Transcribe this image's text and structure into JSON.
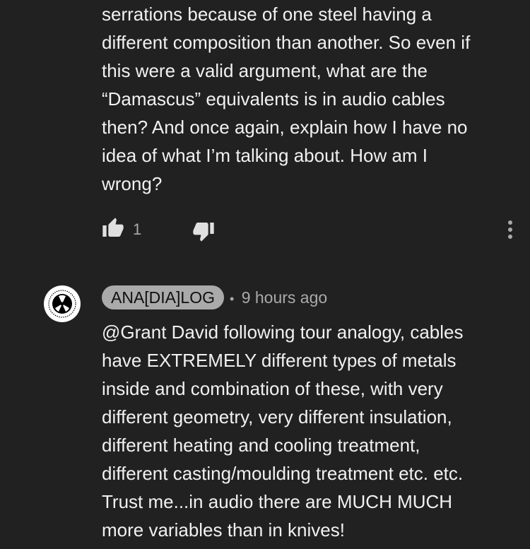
{
  "first_comment": {
    "lines": [
      "serrations because of one steel having a",
      "different composition than another. So even if",
      "this were a valid argument, what are the",
      "“Damascus” equivalents is in audio cables",
      "then? And once again, explain how I have no",
      "idea of what I’m talking about. How am I",
      "wrong?"
    ],
    "like_count": "1",
    "icons": {
      "like": "thumb-up-icon",
      "dislike": "thumb-down-icon",
      "more": "more-vertical-icon"
    }
  },
  "reply": {
    "author": "ANA[DIA]LOG",
    "separator": "•",
    "timestamp": "9 hours ago",
    "avatar_icon": "analog-logo-avatar",
    "lines": [
      "@Grant David following tour analogy, cables",
      "have EXTREMELY different types of metals",
      "inside and combination of these, with very",
      "different geometry, very different insulation,",
      "different heating and cooling treatment,",
      "different casting/moulding treatment etc. etc.",
      "Trust me...in audio there are MUCH MUCH",
      "more variables than in knives!"
    ]
  },
  "colors": {
    "background": "#212121",
    "text": "#f1f1f1",
    "secondary_text": "#aaaaaa",
    "badge_bg": "#aaaaaa"
  }
}
